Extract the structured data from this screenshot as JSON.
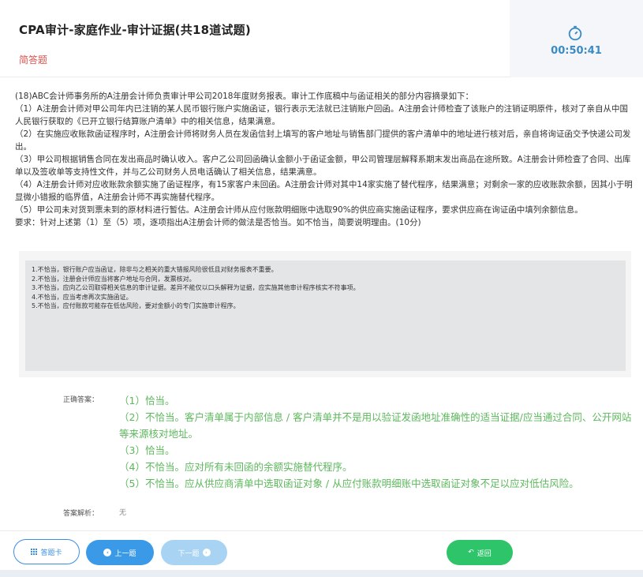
{
  "header": {
    "title": "CPA审计-家庭作业-审计证据(共18道试题)",
    "question_type": "简答题",
    "timer": "00:50:41"
  },
  "question": {
    "paragraphs": [
      "(18)ABC会计师事务所的A注册会计师负责审计甲公司2018年度财务报表。审计工作底稿中与函证相关的部分内容摘录如下：",
      "（1）A注册会计师对甲公司年内已注销的某人民币银行账户实施函证，银行表示无法就已注销账户回函。A注册会计师检查了该账户的注销证明原件，核对了亲自从中国人民银行获取的《已开立银行结算账户清单》中的相关信息，结果满意。",
      "（2）在实施应收账款函证程序时，A注册会计师将财务人员在发函信封上填写的客户地址与销售部门提供的客户清单中的地址进行核对后，亲自将询证函交予快递公司发出。",
      "（3）甲公司根据销售合同在发出商品时确认收入。客户乙公司回函确认金额小于函证金额，甲公司管理层解释系期末发出商品在途所致。A注册会计师检查了合同、出库单以及签收单等支持性文件，并与乙公司财务人员电话确认了相关信息，结果满意。",
      "（4）A注册会计师对应收账款余额实施了函证程序，有15家客户未回函。A注册会计师对其中14家实施了替代程序，结果满意；对剩余一家的应收账款余额，因其小于明显微小错报的临界值，A注册会计师不再实施替代程序。",
      "（5）甲公司未对货到票未到的原材料进行暂估。A注册会计师从应付账款明细账中选取90%的供应商实施函证程序，要求供应商在询证函中填列余额信息。",
      "要求：针对上述第（1）至（5）项，逐项指出A注册会计师的做法是否恰当。如不恰当，简要说明理由。(10分)"
    ]
  },
  "user_answer": {
    "lines": [
      "1.不恰当，银行账户应当函证，除非与之相关的重大错报风险很低且对财务报表不重要。",
      "2.不恰当，注册会计师应当将客户地址与合同，发票核对。",
      "3.不恰当，应向乙公司取得相关信息的审计证据。差异不能仅以口头解释为证据，应实施其他审计程序核实不符事项。",
      "4.不恰当，应当考虑再次实施函证。",
      "5.不恰当，应付账款可能存在低估风险，要对金额小的专门实施审计程序。"
    ]
  },
  "correct_answer": {
    "label": "正确答案：",
    "lines": [
      "（1）恰当。",
      "（2）不恰当。客户清单属于内部信息 / 客户清单并不是用以验证发函地址准确性的适当证据/应当通过合同、公开网站等来源核对地址。",
      "（3）恰当。",
      "（4）不恰当。应对所有未回函的余额实施替代程序。",
      "（5）不恰当。应从供应商清单中选取函证对象 / 从应付账款明细账中选取函证对象不足以应对低估风险。"
    ]
  },
  "analysis": {
    "label": "答案解析：",
    "value": "无"
  },
  "footer": {
    "card_label": "答题卡",
    "prev_label": "上一题",
    "next_label": "下一题",
    "back_label": "返回"
  },
  "colors": {
    "accent": "#3a9ae8",
    "correct": "#5cb85c",
    "question_type": "#d9534f",
    "back": "#2dc46a"
  },
  "icons": [
    "stopwatch-icon",
    "grid-icon",
    "chevron-left-icon",
    "chevron-right-icon",
    "reply-icon"
  ]
}
